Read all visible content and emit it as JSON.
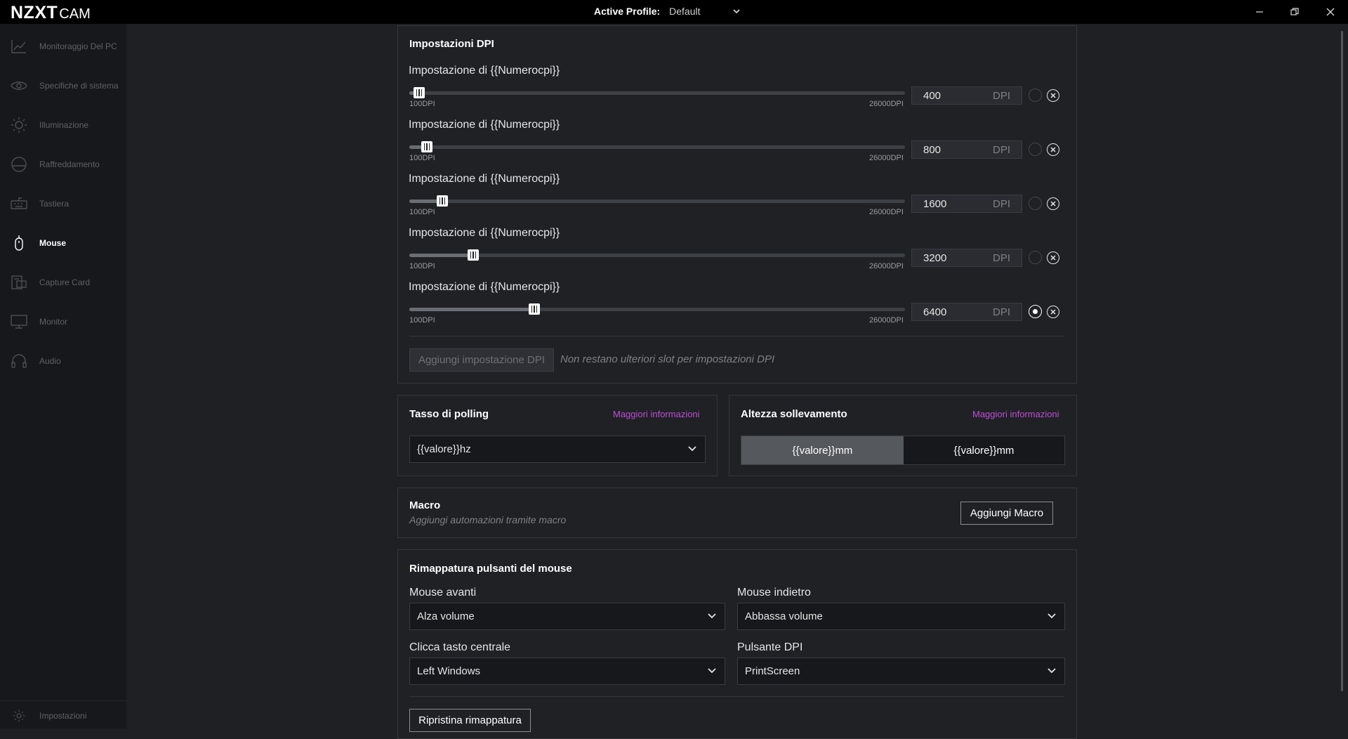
{
  "app": {
    "brand": "NZXT",
    "product": "CAM"
  },
  "header": {
    "profile_label": "Active Profile:",
    "profile_value": "Default"
  },
  "window_controls": [
    "minimize-icon",
    "restore-icon",
    "close-icon"
  ],
  "sidebar": {
    "items": [
      {
        "label": "Monitoraggio Del PC",
        "icon": "chart-line-icon",
        "active": false
      },
      {
        "label": "Specifiche di sistema",
        "icon": "eye-icon",
        "active": false
      },
      {
        "label": "Illuminazione",
        "icon": "sun-icon",
        "active": false
      },
      {
        "label": "Raffreddamento",
        "icon": "fan-icon",
        "active": false
      },
      {
        "label": "Tastiera",
        "icon": "keyboard-icon",
        "active": false
      },
      {
        "label": "Mouse",
        "icon": "mouse-icon",
        "active": true
      },
      {
        "label": "Capture Card",
        "icon": "capture-card-icon",
        "active": false
      },
      {
        "label": "Monitor",
        "icon": "monitor-icon",
        "active": false
      },
      {
        "label": "Audio",
        "icon": "headset-icon",
        "active": false
      }
    ],
    "settings_label": "Impostazioni"
  },
  "dpi": {
    "title": "Impostazioni DPI",
    "min_label": "100DPI",
    "max_label": "26000DPI",
    "min": 100,
    "max": 26000,
    "unit": "DPI",
    "rows": [
      {
        "label": "Impostazione di {{Numerocpi}}",
        "value": "400",
        "selected": false
      },
      {
        "label": "Impostazione di {{Numerocpi}}",
        "value": "800",
        "selected": false
      },
      {
        "label": "Impostazione di {{Numerocpi}}",
        "value": "1600",
        "selected": false
      },
      {
        "label": "Impostazione di {{Numerocpi}}",
        "value": "3200",
        "selected": false
      },
      {
        "label": "Impostazione di {{Numerocpi}}",
        "value": "6400",
        "selected": true
      }
    ],
    "add_button": "Aggiungi impostazione DPI",
    "note": "Non restano ulteriori slot per impostazioni DPI"
  },
  "polling": {
    "title": "Tasso di polling",
    "link": "Maggiori informazioni",
    "value": "{{valore}}hz"
  },
  "lift": {
    "title": "Altezza sollevamento",
    "link": "Maggiori informazioni",
    "options": [
      "{{valore}}mm",
      "{{valore}}mm"
    ],
    "selected_index": 0
  },
  "macro": {
    "title": "Macro",
    "subtitle": "Aggiungi automazioni tramite macro",
    "button": "Aggiungi Macro"
  },
  "remap": {
    "title": "Rimappatura pulsanti del mouse",
    "fields": [
      {
        "label": "Mouse avanti",
        "value": "Alza volume"
      },
      {
        "label": "Mouse indietro",
        "value": "Abbassa volume"
      },
      {
        "label": "Clicca tasto centrale",
        "value": "Left Windows"
      },
      {
        "label": "Pulsante DPI",
        "value": "PrintScreen"
      }
    ],
    "reset_button": "Ripristina rimappatura"
  },
  "colors": {
    "accent": "#c14cd6",
    "background": "#1e2024",
    "sidebar": "#17181b",
    "card": "#1f2125"
  }
}
